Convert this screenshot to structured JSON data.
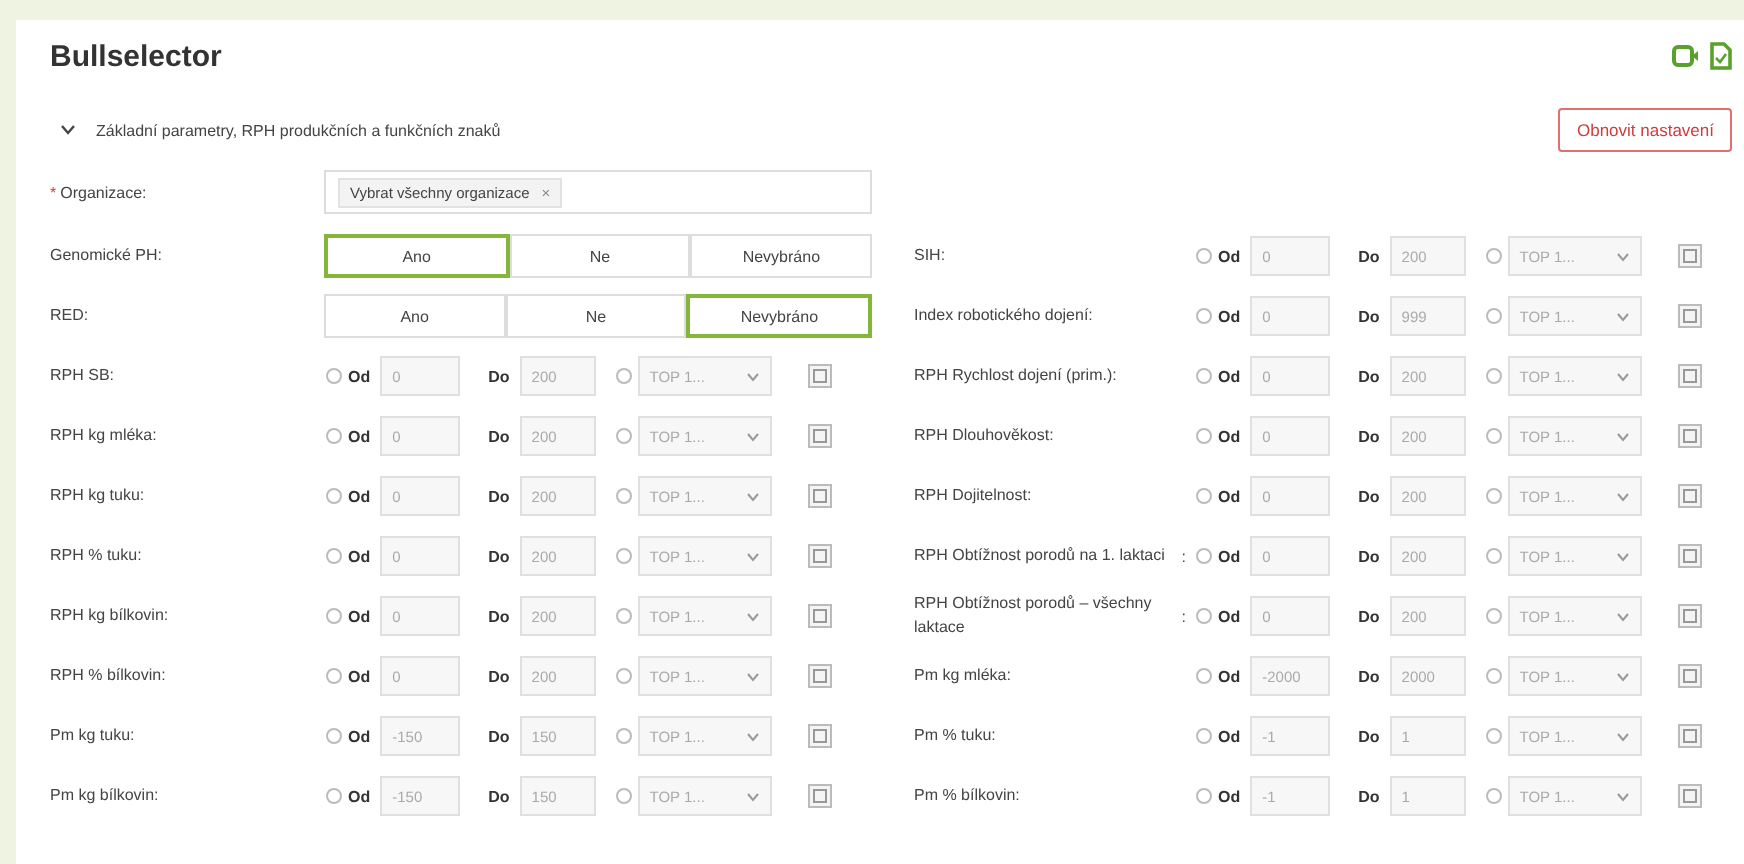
{
  "title": "Bullselector",
  "section": {
    "title": "Základní parametry, RPH produkčních a funkčních znaků",
    "expanded": true
  },
  "reset_button": "Obnovit nastavení",
  "organization": {
    "required_mark": "*",
    "label": "Organizace:",
    "tags": [
      {
        "label": "Vybrat všechny organizace",
        "remove": "×"
      }
    ]
  },
  "left_rows": [
    {
      "kind": "toggle",
      "label": "Genomické PH:",
      "options": [
        {
          "label": "Ano",
          "selected": true
        },
        {
          "label": "Ne",
          "selected": false
        },
        {
          "label": "Nevybráno",
          "selected": false
        }
      ]
    },
    {
      "kind": "toggle",
      "label": "RED:",
      "options": [
        {
          "label": "Ano",
          "selected": false
        },
        {
          "label": "Ne",
          "selected": false
        },
        {
          "label": "Nevybráno",
          "selected": true
        }
      ]
    },
    {
      "kind": "range",
      "label": "RPH SB:",
      "range_selected": false,
      "from_label": "Od",
      "from": "0",
      "to_label": "Do",
      "to": "200",
      "top_selected": false,
      "top": "TOP 1..."
    },
    {
      "kind": "range",
      "label": "RPH kg mléka:",
      "range_selected": false,
      "from_label": "Od",
      "from": "0",
      "to_label": "Do",
      "to": "200",
      "top_selected": false,
      "top": "TOP 1..."
    },
    {
      "kind": "range",
      "label": "RPH kg tuku:",
      "range_selected": false,
      "from_label": "Od",
      "from": "0",
      "to_label": "Do",
      "to": "200",
      "top_selected": false,
      "top": "TOP 1..."
    },
    {
      "kind": "range",
      "label": "RPH % tuku:",
      "range_selected": false,
      "from_label": "Od",
      "from": "0",
      "to_label": "Do",
      "to": "200",
      "top_selected": false,
      "top": "TOP 1..."
    },
    {
      "kind": "range",
      "label": "RPH kg bílkovin:",
      "range_selected": false,
      "from_label": "Od",
      "from": "0",
      "to_label": "Do",
      "to": "200",
      "top_selected": false,
      "top": "TOP 1..."
    },
    {
      "kind": "range",
      "label": "RPH % bílkovin:",
      "range_selected": false,
      "from_label": "Od",
      "from": "0",
      "to_label": "Do",
      "to": "200",
      "top_selected": false,
      "top": "TOP 1..."
    },
    {
      "kind": "range",
      "label": "Pm kg tuku:",
      "range_selected": false,
      "from_label": "Od",
      "from": "-150",
      "to_label": "Do",
      "to": "150",
      "top_selected": false,
      "top": "TOP 1..."
    },
    {
      "kind": "range",
      "label": "Pm kg bílkovin:",
      "range_selected": false,
      "from_label": "Od",
      "from": "-150",
      "to_label": "Do",
      "to": "150",
      "top_selected": false,
      "top": "TOP 1..."
    }
  ],
  "right_rows": [
    {
      "kind": "range",
      "label": "SIH:",
      "range_selected": false,
      "from_label": "Od",
      "from": "0",
      "to_label": "Do",
      "to": "200",
      "top_selected": false,
      "top": "TOP 1..."
    },
    {
      "kind": "range",
      "label": "Index robotického dojení:",
      "range_selected": false,
      "from_label": "Od",
      "from": "0",
      "to_label": "Do",
      "to": "999",
      "top_selected": false,
      "top": "TOP 1..."
    },
    {
      "kind": "range",
      "label": "RPH Rychlost dojení (prim.):",
      "range_selected": false,
      "from_label": "Od",
      "from": "0",
      "to_label": "Do",
      "to": "200",
      "top_selected": false,
      "top": "TOP 1..."
    },
    {
      "kind": "range",
      "label": "RPH Dlouhověkost:",
      "range_selected": false,
      "from_label": "Od",
      "from": "0",
      "to_label": "Do",
      "to": "200",
      "top_selected": false,
      "top": "TOP 1..."
    },
    {
      "kind": "range",
      "label": "RPH Dojitelnost:",
      "range_selected": false,
      "from_label": "Od",
      "from": "0",
      "to_label": "Do",
      "to": "200",
      "top_selected": false,
      "top": "TOP 1..."
    },
    {
      "kind": "range",
      "label": "RPH Obtížnost porodů na 1. laktaci",
      "colon": ":",
      "range_selected": false,
      "from_label": "Od",
      "from": "0",
      "to_label": "Do",
      "to": "200",
      "top_selected": false,
      "top": "TOP 1..."
    },
    {
      "kind": "range",
      "label": "RPH Obtížnost porodů – všechny laktace",
      "colon": ":",
      "range_selected": false,
      "from_label": "Od",
      "from": "0",
      "to_label": "Do",
      "to": "200",
      "top_selected": false,
      "top": "TOP 1..."
    },
    {
      "kind": "range",
      "label": "Pm kg mléka:",
      "range_selected": false,
      "from_label": "Od",
      "from": "-2000",
      "to_label": "Do",
      "to": "2000",
      "top_selected": false,
      "top": "TOP 1..."
    },
    {
      "kind": "range",
      "label": "Pm % tuku:",
      "range_selected": false,
      "from_label": "Od",
      "from": "-1",
      "to_label": "Do",
      "to": "1",
      "top_selected": false,
      "top": "TOP 1..."
    },
    {
      "kind": "range",
      "label": "Pm % bílkovin:",
      "range_selected": false,
      "from_label": "Od",
      "from": "-1",
      "to_label": "Do",
      "to": "1",
      "top_selected": false,
      "top": "TOP 1..."
    }
  ]
}
